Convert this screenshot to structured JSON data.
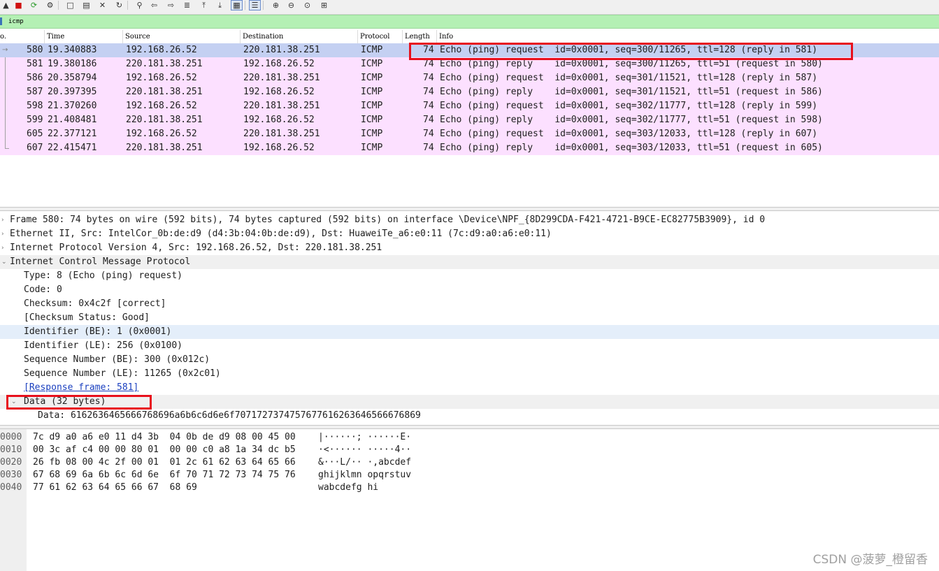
{
  "toolbar": {
    "buttons": [
      {
        "name": "start-capture-icon",
        "glyph": "▲"
      },
      {
        "name": "stop-capture-icon",
        "glyph": "■"
      },
      {
        "name": "restart-capture-icon",
        "glyph": "⟳"
      },
      {
        "name": "capture-options-icon",
        "glyph": "⚙"
      },
      {
        "name": "open-file-icon",
        "glyph": "□"
      },
      {
        "name": "save-file-icon",
        "glyph": "▤"
      },
      {
        "name": "close-file-icon",
        "glyph": "✕"
      },
      {
        "name": "reload-file-icon",
        "glyph": "↻"
      },
      {
        "name": "find-packet-icon",
        "glyph": "⚲"
      },
      {
        "name": "go-back-icon",
        "glyph": "⇦"
      },
      {
        "name": "go-forward-icon",
        "glyph": "⇨"
      },
      {
        "name": "go-to-packet-icon",
        "glyph": "≣"
      },
      {
        "name": "first-packet-icon",
        "glyph": "⤒"
      },
      {
        "name": "last-packet-icon",
        "glyph": "⤓"
      },
      {
        "name": "autoscroll-icon",
        "glyph": "▦"
      },
      {
        "name": "colorize-icon",
        "glyph": "☰"
      },
      {
        "name": "zoom-in-icon",
        "glyph": "⊕"
      },
      {
        "name": "zoom-out-icon",
        "glyph": "⊖"
      },
      {
        "name": "normal-size-icon",
        "glyph": "⊙"
      },
      {
        "name": "resize-columns-icon",
        "glyph": "⊞"
      }
    ]
  },
  "filter": {
    "value": "icmp"
  },
  "columns": [
    "o.",
    "Time",
    "Source",
    "Destination",
    "Protocol",
    "Length",
    "Info"
  ],
  "packets": [
    {
      "no": "580",
      "time": "19.340883",
      "src": "192.168.26.52",
      "dst": "220.181.38.251",
      "proto": "ICMP",
      "len": "74",
      "info": "Echo (ping) request  id=0x0001, seq=300/11265, ttl=128 (reply in 581)"
    },
    {
      "no": "581",
      "time": "19.380186",
      "src": "220.181.38.251",
      "dst": "192.168.26.52",
      "proto": "ICMP",
      "len": "74",
      "info": "Echo (ping) reply    id=0x0001, seq=300/11265, ttl=51 (request in 580)"
    },
    {
      "no": "586",
      "time": "20.358794",
      "src": "192.168.26.52",
      "dst": "220.181.38.251",
      "proto": "ICMP",
      "len": "74",
      "info": "Echo (ping) request  id=0x0001, seq=301/11521, ttl=128 (reply in 587)"
    },
    {
      "no": "587",
      "time": "20.397395",
      "src": "220.181.38.251",
      "dst": "192.168.26.52",
      "proto": "ICMP",
      "len": "74",
      "info": "Echo (ping) reply    id=0x0001, seq=301/11521, ttl=51 (request in 586)"
    },
    {
      "no": "598",
      "time": "21.370260",
      "src": "192.168.26.52",
      "dst": "220.181.38.251",
      "proto": "ICMP",
      "len": "74",
      "info": "Echo (ping) request  id=0x0001, seq=302/11777, ttl=128 (reply in 599)"
    },
    {
      "no": "599",
      "time": "21.408481",
      "src": "220.181.38.251",
      "dst": "192.168.26.52",
      "proto": "ICMP",
      "len": "74",
      "info": "Echo (ping) reply    id=0x0001, seq=302/11777, ttl=51 (request in 598)"
    },
    {
      "no": "605",
      "time": "22.377121",
      "src": "192.168.26.52",
      "dst": "220.181.38.251",
      "proto": "ICMP",
      "len": "74",
      "info": "Echo (ping) request  id=0x0001, seq=303/12033, ttl=128 (reply in 607)"
    },
    {
      "no": "607",
      "time": "22.415471",
      "src": "220.181.38.251",
      "dst": "192.168.26.52",
      "proto": "ICMP",
      "len": "74",
      "info": "Echo (ping) reply    id=0x0001, seq=303/12033, ttl=51 (request in 605)"
    }
  ],
  "details": [
    {
      "text": "Frame 580: 74 bytes on wire (592 bits), 74 bytes captured (592 bits) on interface \\Device\\NPF_{8D299CDA-F421-4721-B9CE-EC82775B3909}, id 0",
      "arrow": "›"
    },
    {
      "text": "Ethernet II, Src: IntelCor_0b:de:d9 (d4:3b:04:0b:de:d9), Dst: HuaweiTe_a6:e0:11 (7c:d9:a0:a6:e0:11)",
      "arrow": "›"
    },
    {
      "text": "Internet Protocol Version 4, Src: 192.168.26.52, Dst: 220.181.38.251",
      "arrow": "›"
    },
    {
      "text": "Internet Control Message Protocol",
      "arrow": "⌄"
    },
    {
      "text": "Type: 8 (Echo (ping) request)"
    },
    {
      "text": "Code: 0"
    },
    {
      "text": "Checksum: 0x4c2f [correct]"
    },
    {
      "text": "[Checksum Status: Good]"
    },
    {
      "text": "Identifier (BE): 1 (0x0001)"
    },
    {
      "text": "Identifier (LE): 256 (0x0100)"
    },
    {
      "text": "Sequence Number (BE): 300 (0x012c)"
    },
    {
      "text": "Sequence Number (LE): 11265 (0x2c01)"
    },
    {
      "text": "[Response frame: 581]"
    },
    {
      "text": "Data (32 bytes)",
      "arrow": "⌄"
    },
    {
      "text": "Data: 6162636465666768696a6b6c6d6e6f7071727374757677616263646566676869"
    }
  ],
  "hex": [
    {
      "off": "0000",
      "bytes": "7c d9 a0 a6 e0 11 d4 3b  04 0b de d9 08 00 45 00",
      "ascii": "|······; ······E·"
    },
    {
      "off": "0010",
      "bytes": "00 3c af c4 00 00 80 01  00 00 c0 a8 1a 34 dc b5",
      "ascii": "·<······ ·····4··"
    },
    {
      "off": "0020",
      "bytes": "26 fb 08 00 4c 2f 00 01  01 2c 61 62 63 64 65 66",
      "ascii": "&···L/·· ·,abcdef"
    },
    {
      "off": "0030",
      "bytes": "67 68 69 6a 6b 6c 6d 6e  6f 70 71 72 73 74 75 76",
      "ascii": "ghijklmn opqrstuv"
    },
    {
      "off": "0040",
      "bytes": "77 61 62 63 64 65 66 67  68 69",
      "ascii": "wabcdefg hi"
    }
  ],
  "watermark": "CSDN @菠萝_橙留香",
  "colors": {
    "selected_row": "#c4d0f2",
    "icmp_row": "#fce0ff",
    "filter_bg": "#b4f0b4",
    "highlight": "#e8101c",
    "link": "#1a3fbf"
  }
}
